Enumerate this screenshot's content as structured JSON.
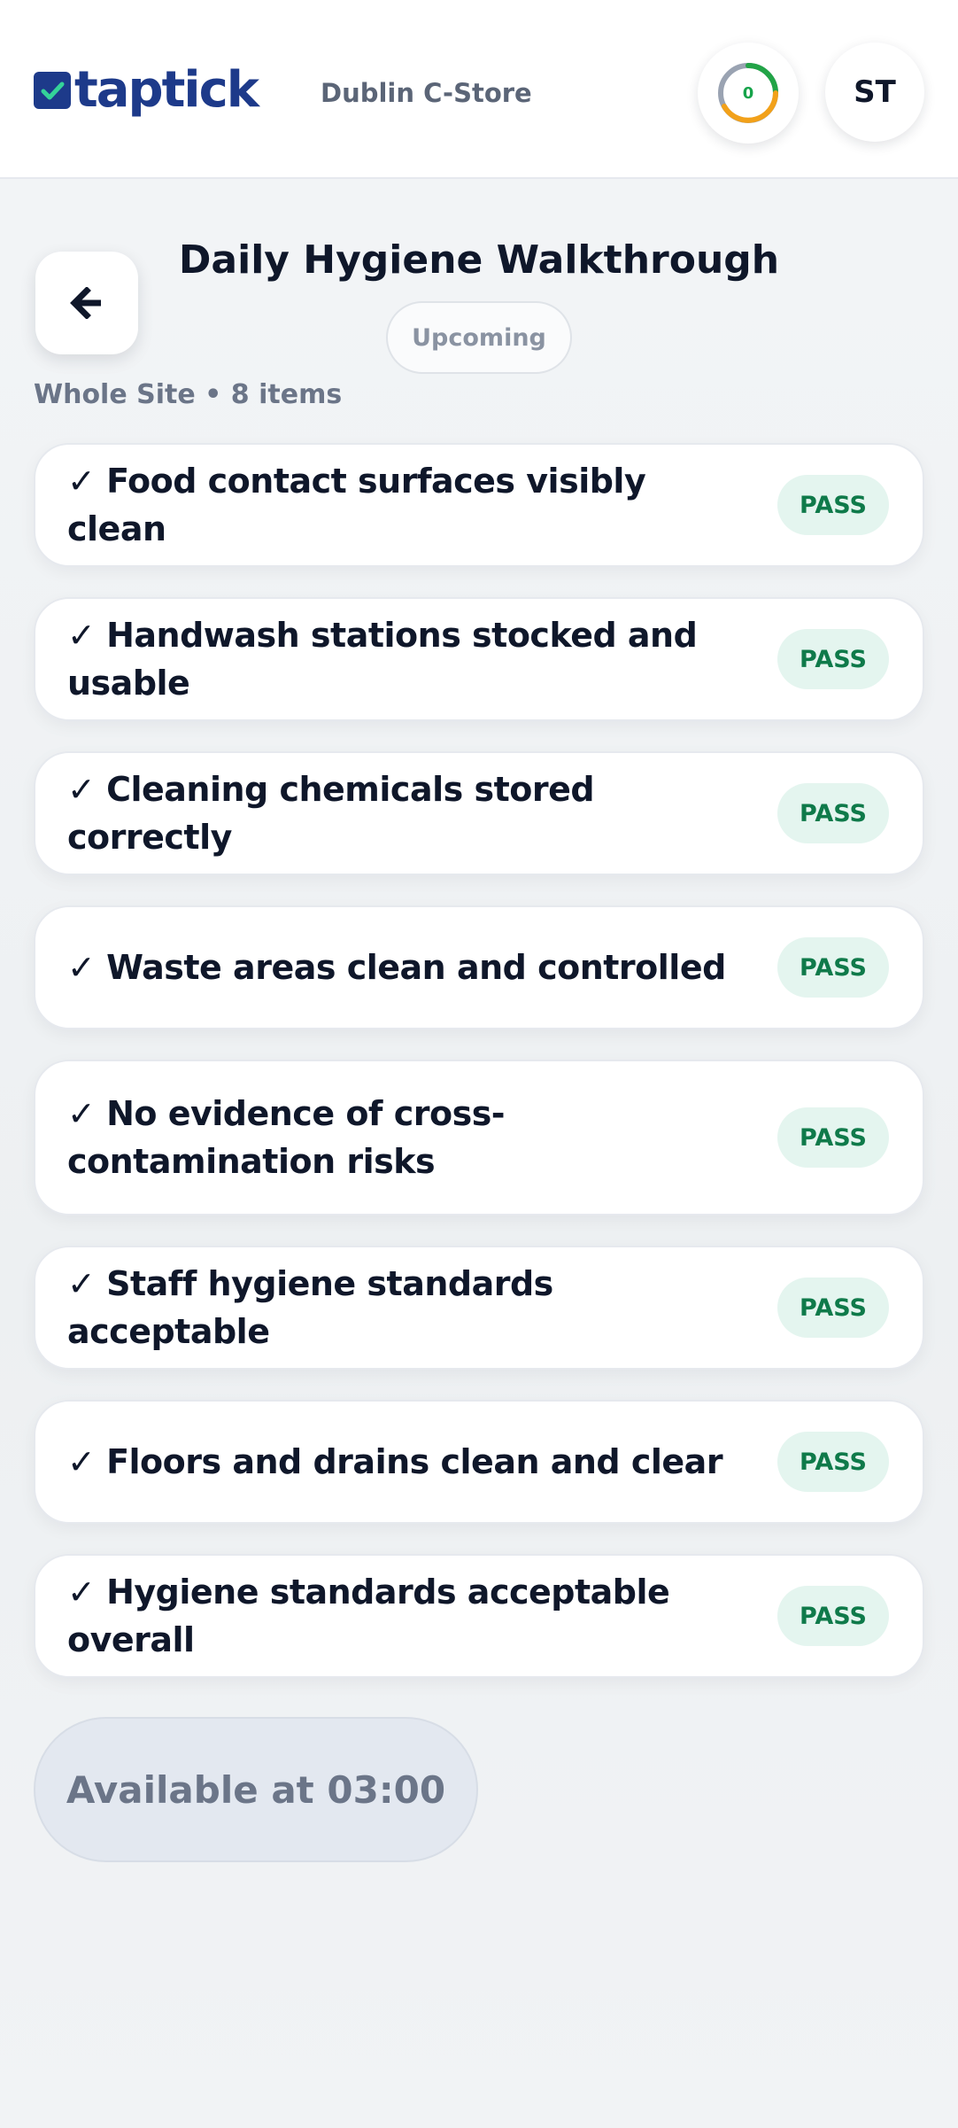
{
  "header": {
    "logo_text": "taptick",
    "store_name": "Dublin C-Store",
    "progress_count": "0",
    "avatar_initials": "ST"
  },
  "page": {
    "title": "Daily Hygiene Walkthrough",
    "status": "Upcoming",
    "subtitle": "Whole Site • 8 items"
  },
  "checklist": [
    {
      "label": "✓ Food contact surfaces visibly clean",
      "result": "PASS"
    },
    {
      "label": "✓ Handwash stations stocked and usable",
      "result": "PASS"
    },
    {
      "label": "✓ Cleaning chemicals stored correctly",
      "result": "PASS"
    },
    {
      "label": "✓ Waste areas clean and controlled",
      "result": "PASS"
    },
    {
      "label": "✓ No evidence of cross-contamination risks",
      "result": "PASS"
    },
    {
      "label": "✓ Staff hygiene standards acceptable",
      "result": "PASS"
    },
    {
      "label": "✓ Floors and drains clean and clear",
      "result": "PASS"
    },
    {
      "label": "✓ Hygiene standards acceptable overall",
      "result": "PASS"
    }
  ],
  "footer": {
    "available_label": "Available at 03:00"
  },
  "colors": {
    "brand": "#1d3a8a",
    "pass_text": "#0f7a4a",
    "pass_bg": "#e4f5ef",
    "ring_green": "#22a447",
    "ring_orange": "#f2a11a",
    "ring_grey": "#9aa3b2"
  },
  "icons": {
    "logo": "checkbox-logo-icon",
    "back": "arrow-left-icon",
    "progress": "progress-ring-icon"
  }
}
